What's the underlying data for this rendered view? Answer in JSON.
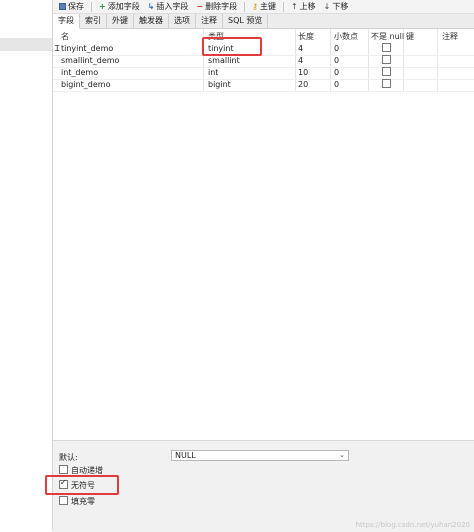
{
  "toolbar": {
    "save": "保存",
    "add_field": "添加字段",
    "insert_field": "插入字段",
    "delete_field": "删除字段",
    "primary_key": "主键",
    "move_up": "上移",
    "move_down": "下移"
  },
  "tabs": [
    "字段",
    "索引",
    "外键",
    "触发器",
    "选项",
    "注释",
    "SQL 预览"
  ],
  "columns": [
    "名",
    "类型",
    "长度",
    "小数点",
    "不是 null",
    "键",
    "注释"
  ],
  "rows": [
    {
      "name": "tinyint_demo",
      "type": "tinyint",
      "length": "4",
      "decimal": "0",
      "not_null": false
    },
    {
      "name": "smallint_demo",
      "type": "smallint",
      "length": "4",
      "decimal": "0",
      "not_null": false
    },
    {
      "name": "int_demo",
      "type": "int",
      "length": "10",
      "decimal": "0",
      "not_null": false
    },
    {
      "name": "bigint_demo",
      "type": "bigint",
      "length": "20",
      "decimal": "0",
      "not_null": false
    }
  ],
  "bottom": {
    "default_label": "默认:",
    "default_value": "NULL",
    "auto_increment": "自动递增",
    "unsigned": "无符号",
    "zerofill": "填充零",
    "unsigned_checked": true,
    "auto_increment_checked": false,
    "zerofill_checked": false
  },
  "watermark": "https://blog.csdn.net/yuhan2020",
  "colors": {
    "highlight": "#e23b3b"
  }
}
